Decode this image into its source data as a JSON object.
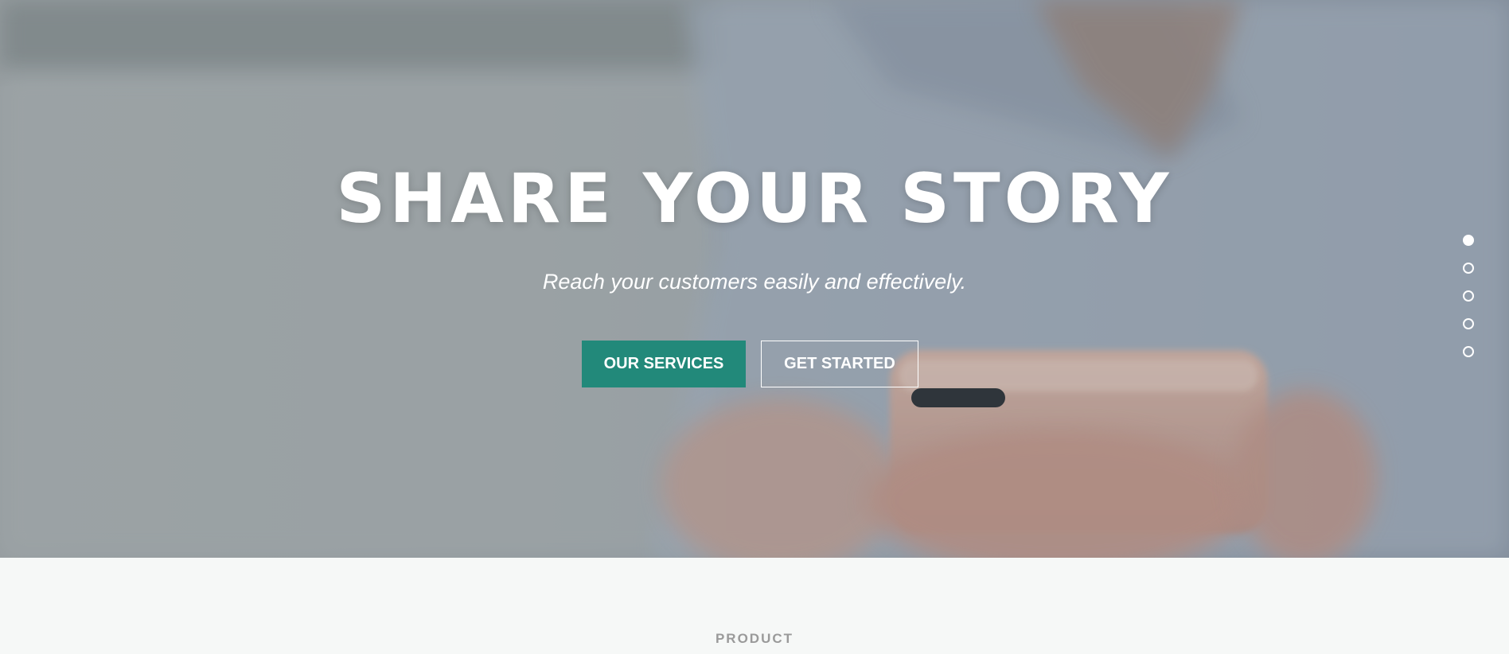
{
  "hero": {
    "title": "SHARE YOUR STORY",
    "subtitle": "Reach your customers easily and effectively.",
    "primary_button": "OUR SERVICES",
    "secondary_button": "GET STARTED",
    "slider": {
      "count": 5,
      "active_index": 0
    }
  },
  "section": {
    "label": "PRODUCT"
  },
  "colors": {
    "accent": "#22897a",
    "text_light": "#ffffff",
    "section_bg": "#f6f8f7",
    "section_label": "#9a9a9a"
  }
}
